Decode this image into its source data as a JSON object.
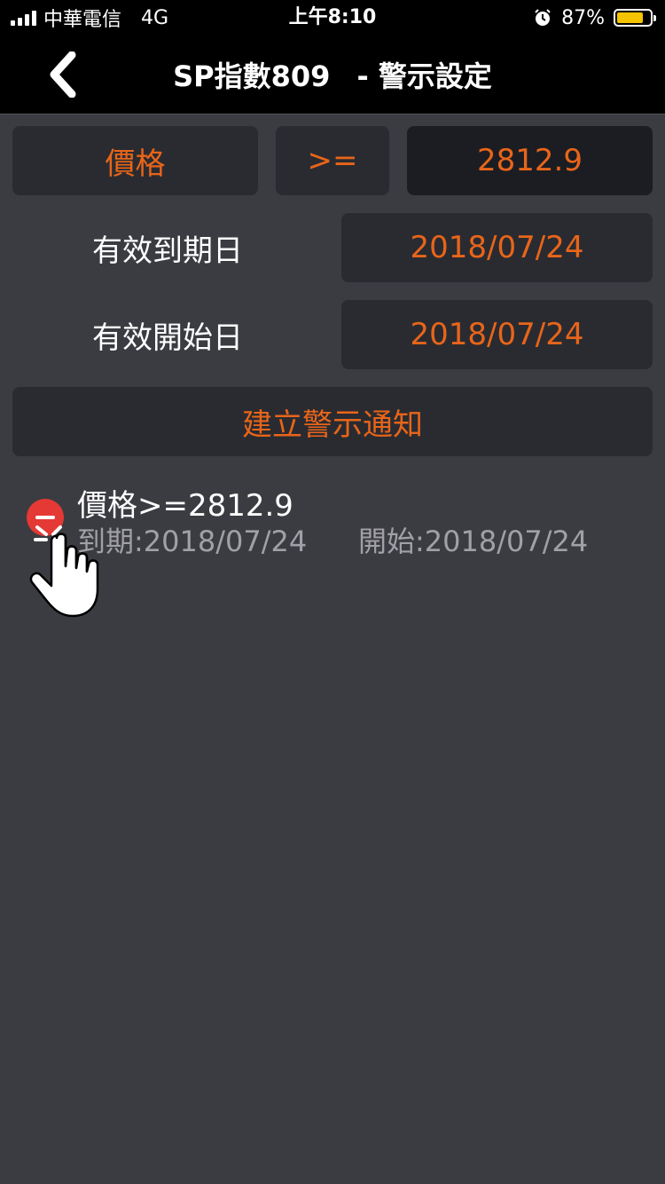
{
  "status": {
    "carrier": "中華電信",
    "network": "4G",
    "time": "上午8:10",
    "battery": "87%",
    "battery_level": 0.87
  },
  "nav": {
    "title_main": "SP指數809",
    "title_sub": "- 警示設定",
    "back_icon": "chevron-left-icon"
  },
  "form": {
    "type_label": "價格",
    "operator_label": ">=",
    "price_value": "2812.9",
    "expiry_label": "有效到期日",
    "expiry_value": "2018/07/24",
    "start_label": "有效開始日",
    "start_value": "2018/07/24",
    "create_button": "建立警示通知"
  },
  "alerts": [
    {
      "condition": "價格>=2812.9",
      "expiry": "到期:2018/07/24",
      "start": "開始:2018/07/24"
    }
  ],
  "colors": {
    "accent": "#e8651a",
    "background": "#3b3c42",
    "delete": "#e53935",
    "battery": "#f5c400"
  }
}
